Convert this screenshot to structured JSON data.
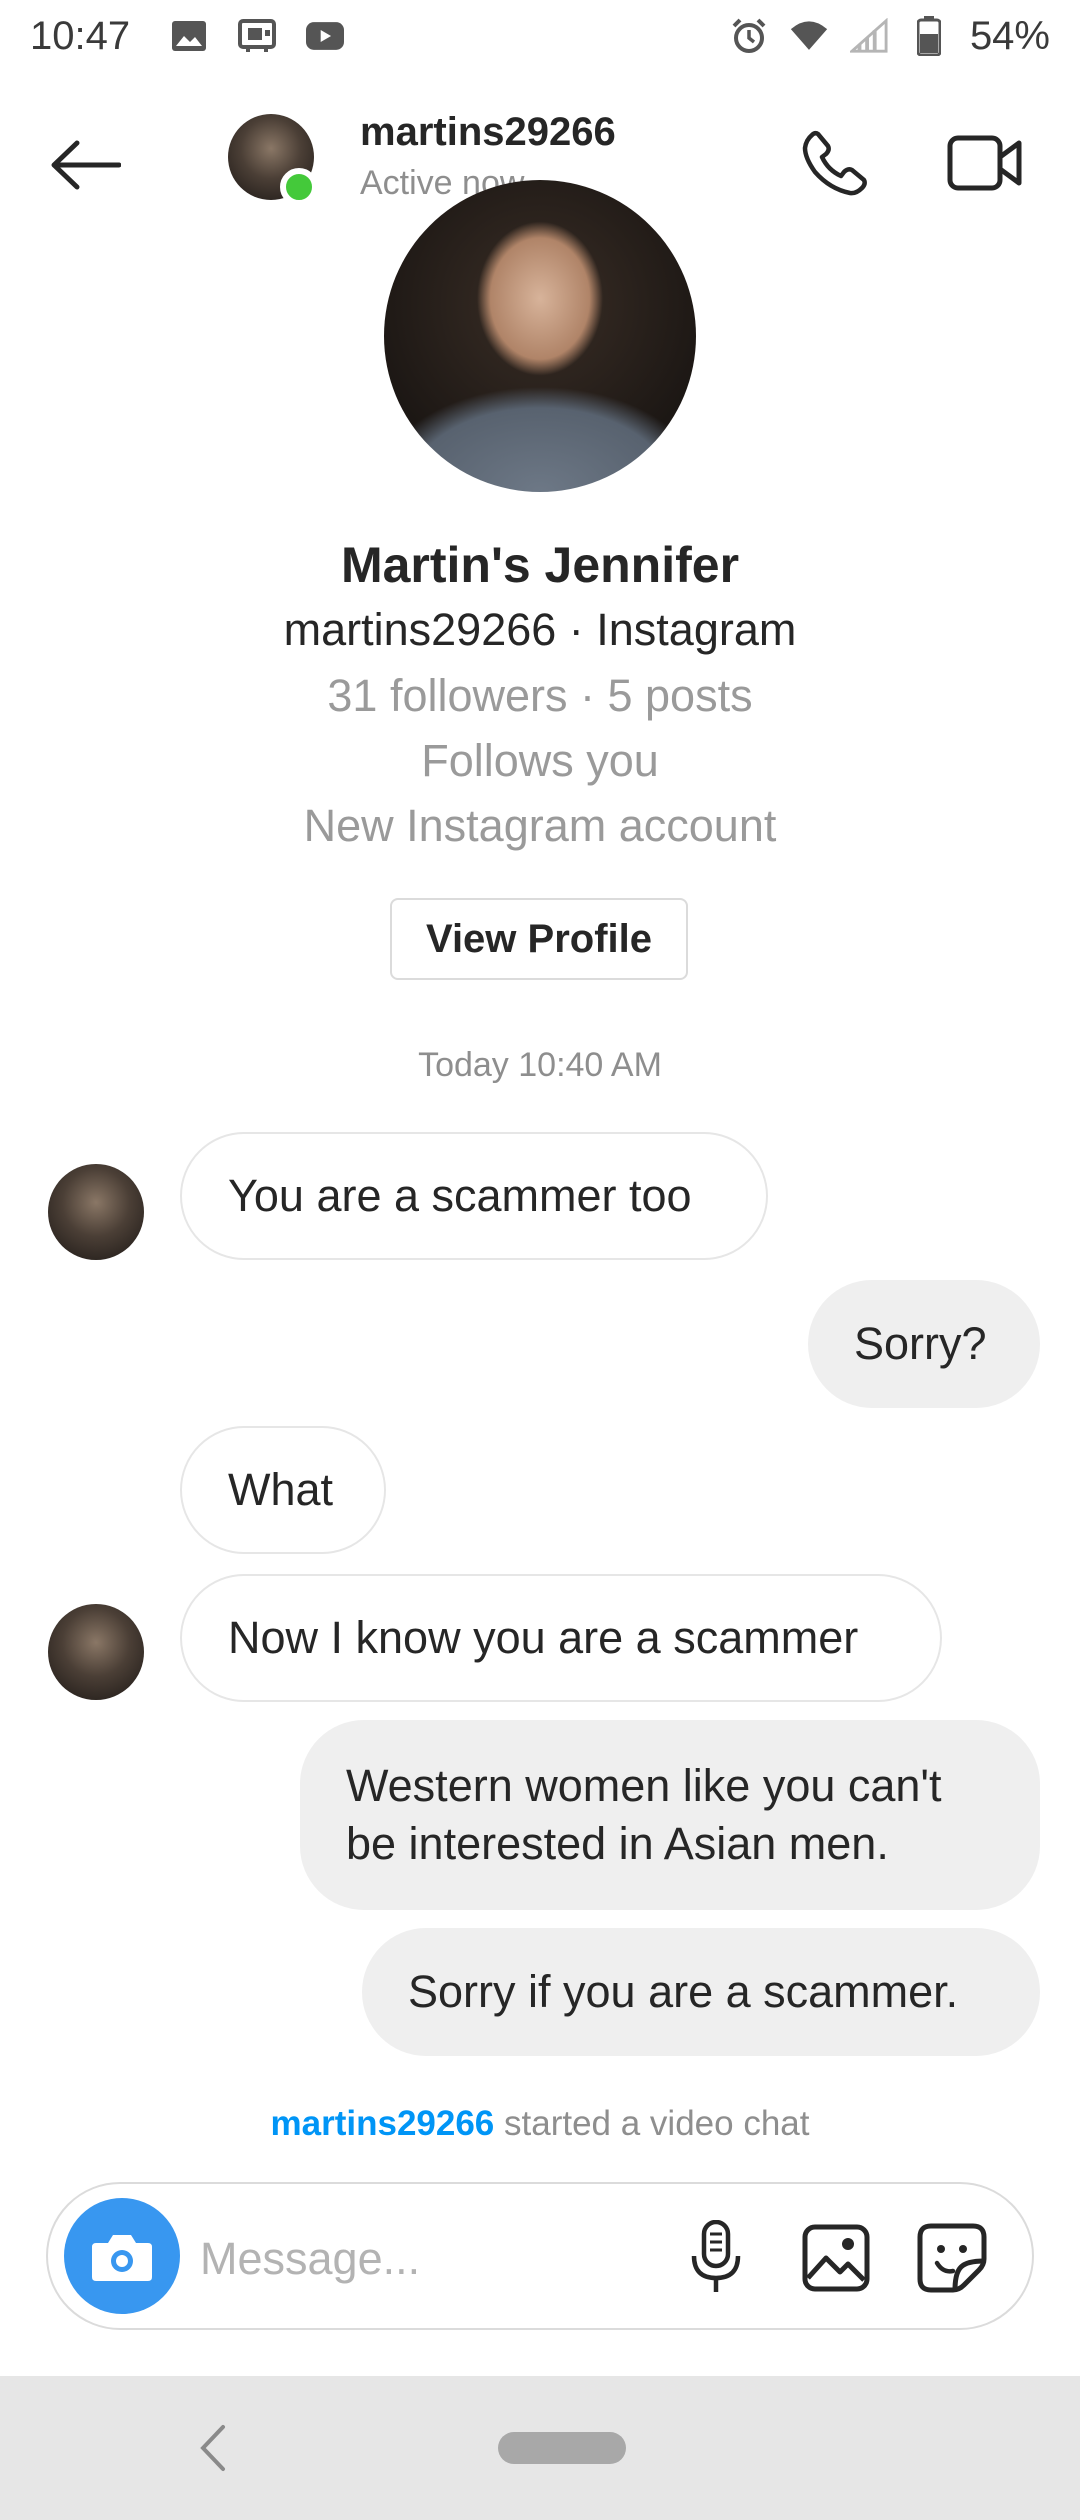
{
  "status_bar": {
    "time": "10:47",
    "battery": "54%",
    "left_icons": [
      "image-icon",
      "cast-icon",
      "youtube-icon"
    ],
    "right_icons": [
      "alarm-icon",
      "wifi-icon",
      "signal-icon",
      "battery-icon"
    ]
  },
  "header": {
    "username": "martins29266",
    "status": "Active now",
    "icons": [
      "back-arrow-icon",
      "phone-icon",
      "video-camera-icon"
    ]
  },
  "profile": {
    "display_name": "Martin's Jennifer",
    "handle_line": "martins29266 · Instagram",
    "stats": "31 followers · 5 posts",
    "follows_you": "Follows you",
    "new_account": "New Instagram account",
    "view_profile_label": "View Profile"
  },
  "conversation": {
    "timestamp": "Today 10:40 AM",
    "messages": [
      {
        "from": "them",
        "text": "You are a scammer too"
      },
      {
        "from": "me",
        "text": "Sorry?"
      },
      {
        "from": "them",
        "text": "What"
      },
      {
        "from": "them",
        "text": "Now I know you are a scammer"
      },
      {
        "from": "me",
        "text": "Western women like you can't be interested in Asian men."
      },
      {
        "from": "me",
        "text": "Sorry if you are a scammer."
      }
    ],
    "video_chat_user": "martins29266",
    "video_chat_text": "started a video chat"
  },
  "composer": {
    "placeholder": "Message...",
    "accent": "#3897f0",
    "icons": [
      "camera-icon",
      "microphone-icon",
      "gallery-icon",
      "sticker-icon"
    ]
  },
  "colors": {
    "link": "#0095f6",
    "online": "#44c93a",
    "outgoing_bubble": "#efefef"
  }
}
